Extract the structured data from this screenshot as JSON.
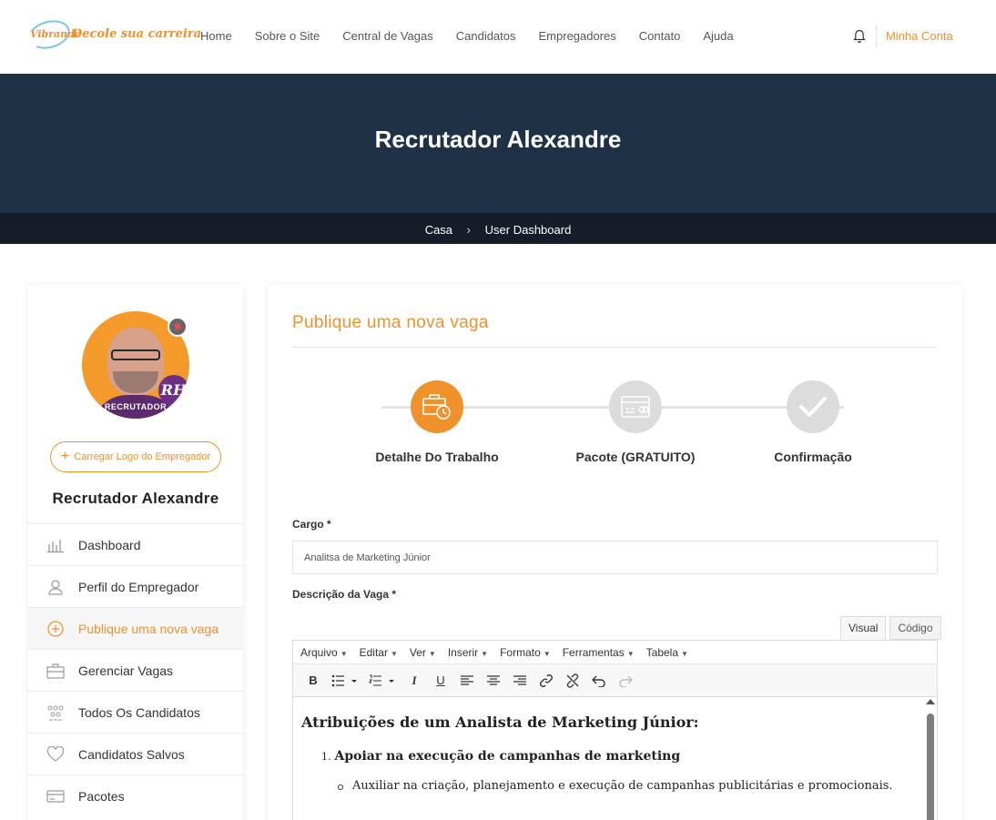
{
  "header": {
    "logo_mark": "Vibrando",
    "logo_slogan": "Decole sua carreira",
    "nav": [
      "Home",
      "Sobre o Site",
      "Central de Vagas",
      "Candidatos",
      "Empregadores",
      "Contato",
      "Ajuda"
    ],
    "account_label": "Minha Conta"
  },
  "banner": {
    "title": "Recrutador Alexandre",
    "breadcrumb": [
      "Casa",
      "User Dashboard"
    ]
  },
  "sidebar": {
    "avatar_badge_text": "RH",
    "avatar_tag": "RECRUTADOR",
    "upload_label": "Carregar Logo do Empregador",
    "name": "Recrutador Alexandre",
    "menu": [
      {
        "label": "Dashboard",
        "icon": "dashboard-icon"
      },
      {
        "label": "Perfil do Empregador",
        "icon": "user-icon"
      },
      {
        "label": "Publique uma nova vaga",
        "icon": "plus-circle-icon",
        "active": true
      },
      {
        "label": "Gerenciar Vagas",
        "icon": "briefcase-icon"
      },
      {
        "label": "Todos Os Candidatos",
        "icon": "people-icon"
      },
      {
        "label": "Candidatos Salvos",
        "icon": "heart-icon"
      },
      {
        "label": "Pacotes",
        "icon": "card-icon"
      }
    ]
  },
  "main": {
    "title": "Publique uma nova vaga",
    "steps": [
      {
        "label": "Detalhe Do Trabalho",
        "icon": "briefcase-clock-icon",
        "state": "active"
      },
      {
        "label": "Pacote (GRATUITO)",
        "icon": "credit-card-icon",
        "state": "pending"
      },
      {
        "label": "Confirmação",
        "icon": "check-icon",
        "state": "pending"
      }
    ],
    "cargo_label": "Cargo *",
    "cargo_value": "Analitsa de Marketing Júnior",
    "descricao_label": "Descrição da Vaga *",
    "editor": {
      "tabs": [
        "Visual",
        "Código"
      ],
      "active_tab": "Visual",
      "menus": [
        "Arquivo",
        "Editar",
        "Ver",
        "Inserir",
        "Formato",
        "Ferramentas",
        "Tabela"
      ],
      "content_heading": "Atribuições de um Analista de Marketing Júnior:",
      "list_number": "1.",
      "list_item": "Apoiar na execução de campanhas de marketing",
      "sub_item": "Auxiliar na criação, planejamento e execução de campanhas publicitárias e promocionais."
    }
  },
  "colors": {
    "accent": "#f0922b",
    "banner": "#1f3245",
    "breadcrumb_bar": "#151e28"
  }
}
